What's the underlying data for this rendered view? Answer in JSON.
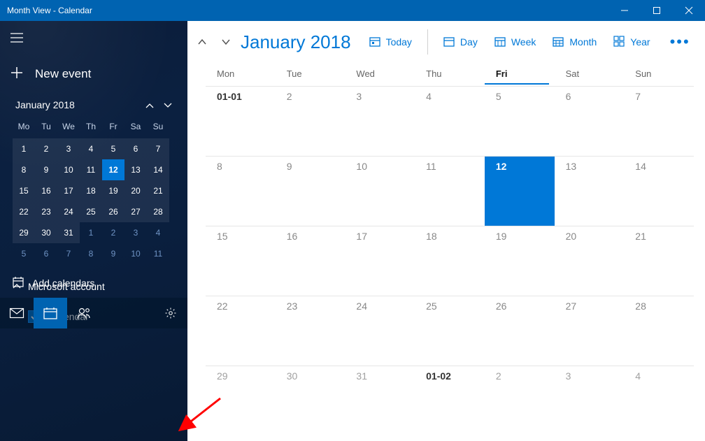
{
  "window": {
    "title": "Month View - Calendar"
  },
  "sidebar": {
    "new_event_label": "New event",
    "mini_cal_title": "January 2018",
    "mini_days": [
      "Mo",
      "Tu",
      "We",
      "Th",
      "Fr",
      "Sa",
      "Su"
    ],
    "mini_weeks": [
      [
        {
          "d": "1",
          "t": "cur"
        },
        {
          "d": "2",
          "t": "cur"
        },
        {
          "d": "3",
          "t": "cur"
        },
        {
          "d": "4",
          "t": "cur"
        },
        {
          "d": "5",
          "t": "cur"
        },
        {
          "d": "6",
          "t": "cur"
        },
        {
          "d": "7",
          "t": "cur"
        }
      ],
      [
        {
          "d": "8",
          "t": "cur"
        },
        {
          "d": "9",
          "t": "cur"
        },
        {
          "d": "10",
          "t": "cur"
        },
        {
          "d": "11",
          "t": "cur"
        },
        {
          "d": "12",
          "t": "today"
        },
        {
          "d": "13",
          "t": "cur"
        },
        {
          "d": "14",
          "t": "cur"
        }
      ],
      [
        {
          "d": "15",
          "t": "cur"
        },
        {
          "d": "16",
          "t": "cur"
        },
        {
          "d": "17",
          "t": "cur"
        },
        {
          "d": "18",
          "t": "cur"
        },
        {
          "d": "19",
          "t": "cur"
        },
        {
          "d": "20",
          "t": "cur"
        },
        {
          "d": "21",
          "t": "cur"
        }
      ],
      [
        {
          "d": "22",
          "t": "cur"
        },
        {
          "d": "23",
          "t": "cur"
        },
        {
          "d": "24",
          "t": "cur"
        },
        {
          "d": "25",
          "t": "cur"
        },
        {
          "d": "26",
          "t": "cur"
        },
        {
          "d": "27",
          "t": "cur"
        },
        {
          "d": "28",
          "t": "cur"
        }
      ],
      [
        {
          "d": "29",
          "t": "cur"
        },
        {
          "d": "30",
          "t": "cur"
        },
        {
          "d": "31",
          "t": "cur"
        },
        {
          "d": "1",
          "t": "other"
        },
        {
          "d": "2",
          "t": "other"
        },
        {
          "d": "3",
          "t": "other"
        },
        {
          "d": "4",
          "t": "other"
        }
      ],
      [
        {
          "d": "5",
          "t": "other"
        },
        {
          "d": "6",
          "t": "other"
        },
        {
          "d": "7",
          "t": "other"
        },
        {
          "d": "8",
          "t": "other"
        },
        {
          "d": "9",
          "t": "other"
        },
        {
          "d": "10",
          "t": "other"
        },
        {
          "d": "11",
          "t": "other"
        }
      ]
    ],
    "account_label": "Microsoft account",
    "calendar_label": "Calendar",
    "add_calendars_label": "Add calendars"
  },
  "toolbar": {
    "month_title": "January 2018",
    "today_label": "Today",
    "views": {
      "day": "Day",
      "week": "Week",
      "month": "Month",
      "year": "Year"
    }
  },
  "grid": {
    "headers": [
      "Mon",
      "Tue",
      "Wed",
      "Thu",
      "Fri",
      "Sat",
      "Sun"
    ],
    "today_col": 4,
    "weeks": [
      [
        {
          "d": "01-01",
          "cls": "bold"
        },
        {
          "d": "2"
        },
        {
          "d": "3"
        },
        {
          "d": "4"
        },
        {
          "d": "5"
        },
        {
          "d": "6"
        },
        {
          "d": "7"
        }
      ],
      [
        {
          "d": "8"
        },
        {
          "d": "9"
        },
        {
          "d": "10"
        },
        {
          "d": "11"
        },
        {
          "d": "12",
          "cls": "selected"
        },
        {
          "d": "13"
        },
        {
          "d": "14"
        }
      ],
      [
        {
          "d": "15"
        },
        {
          "d": "16"
        },
        {
          "d": "17"
        },
        {
          "d": "18"
        },
        {
          "d": "19"
        },
        {
          "d": "20"
        },
        {
          "d": "21"
        }
      ],
      [
        {
          "d": "22"
        },
        {
          "d": "23"
        },
        {
          "d": "24"
        },
        {
          "d": "25"
        },
        {
          "d": "26"
        },
        {
          "d": "27"
        },
        {
          "d": "28"
        }
      ],
      [
        {
          "d": "29"
        },
        {
          "d": "30"
        },
        {
          "d": "31"
        },
        {
          "d": "01-02",
          "cls": "oth"
        },
        {
          "d": "2"
        },
        {
          "d": "3"
        },
        {
          "d": "4"
        }
      ]
    ]
  },
  "colors": {
    "accent": "#0078d7",
    "titlebar": "#0063b1"
  }
}
